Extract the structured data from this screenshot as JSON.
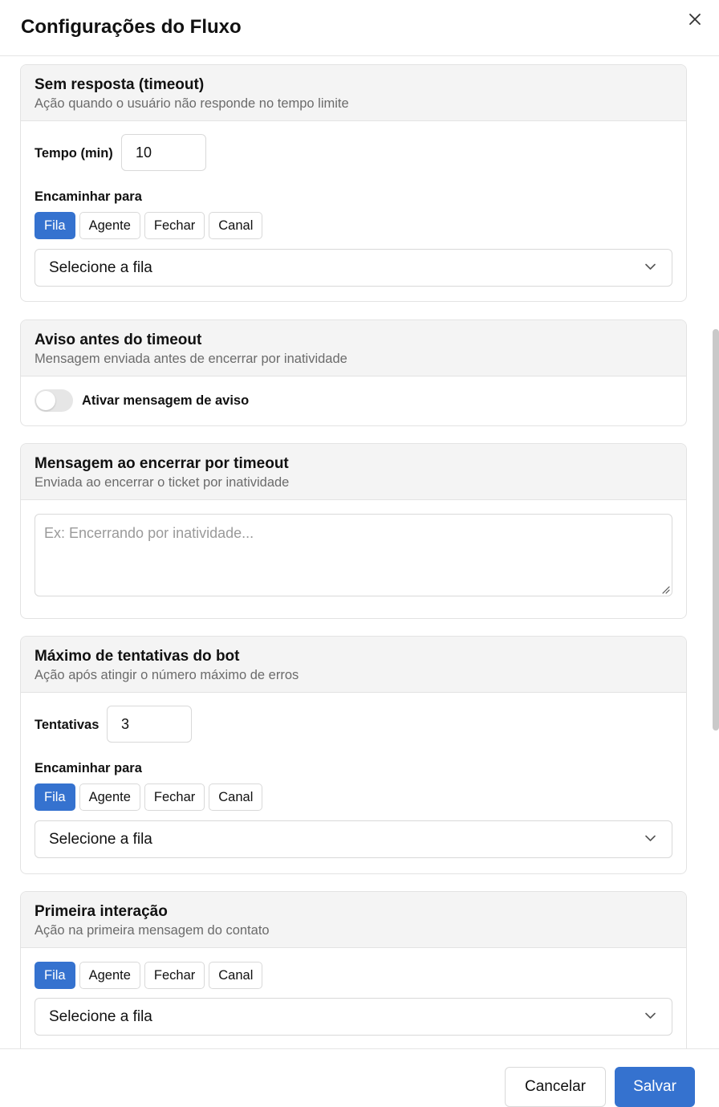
{
  "dialog": {
    "title": "Configurações do Fluxo",
    "close_icon": "close-icon"
  },
  "timeout": {
    "title": "Sem resposta (timeout)",
    "subtitle": "Ação quando o usuário não responde no tempo limite",
    "time_label": "Tempo (min)",
    "time_value": "10",
    "forward_label": "Encaminhar para",
    "options": [
      "Fila",
      "Agente",
      "Fechar",
      "Canal"
    ],
    "selected_option": "Fila",
    "select_placeholder": "Selecione a fila"
  },
  "warning": {
    "title": "Aviso antes do timeout",
    "subtitle": "Mensagem enviada antes de encerrar por inatividade",
    "toggle_label": "Ativar mensagem de aviso",
    "toggle_on": false
  },
  "closing_message": {
    "title": "Mensagem ao encerrar por timeout",
    "subtitle": "Enviada ao encerrar o ticket por inatividade",
    "placeholder": "Ex: Encerrando por inatividade..."
  },
  "max_attempts": {
    "title": "Máximo de tentativas do bot",
    "subtitle": "Ação após atingir o número máximo de erros",
    "attempts_label": "Tentativas",
    "attempts_value": "3",
    "forward_label": "Encaminhar para",
    "options": [
      "Fila",
      "Agente",
      "Fechar",
      "Canal"
    ],
    "selected_option": "Fila",
    "select_placeholder": "Selecione a fila"
  },
  "first_interaction": {
    "title": "Primeira interação",
    "subtitle": "Ação na primeira mensagem do contato",
    "options": [
      "Fila",
      "Agente",
      "Fechar",
      "Canal"
    ],
    "selected_option": "Fila",
    "select_placeholder": "Selecione a fila"
  },
  "footer": {
    "cancel_label": "Cancelar",
    "save_label": "Salvar"
  },
  "colors": {
    "accent": "#3572cf",
    "header_bg": "#f4f4f4",
    "border": "#e3e3e3"
  }
}
